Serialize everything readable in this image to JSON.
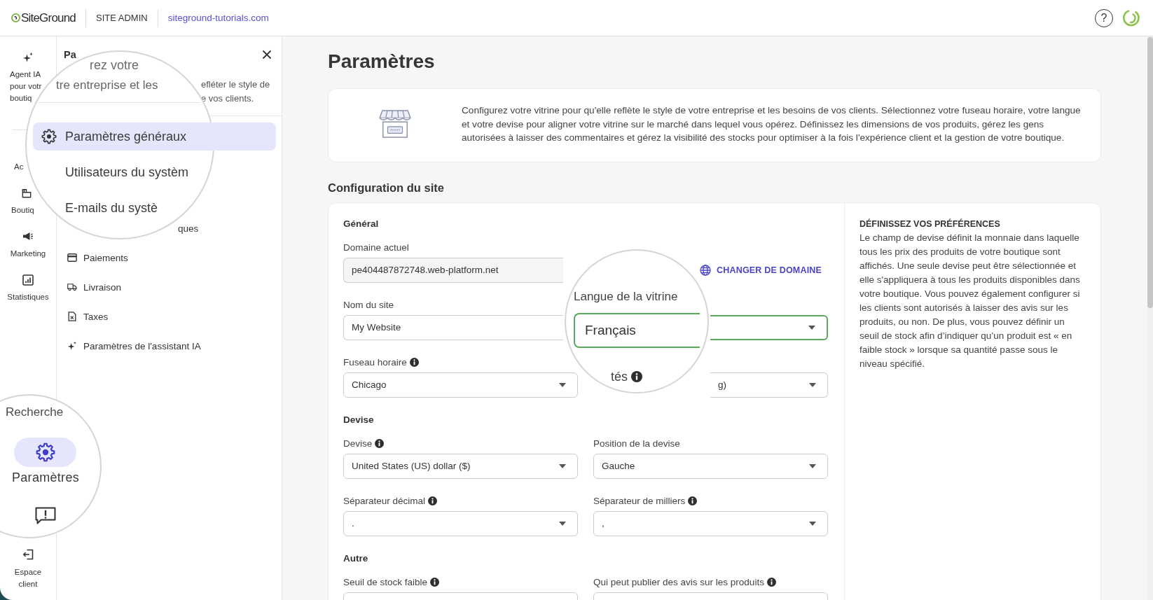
{
  "topbar": {
    "logo": "SiteGround",
    "section": "SITE ADMIN",
    "site_link": "siteground-tutorials.com",
    "help": "?"
  },
  "rail": {
    "items": [
      {
        "lines": [
          "Agent IA",
          "pour votr",
          "boutiq"
        ],
        "selected": false
      },
      {
        "lines": [
          "Ac"
        ],
        "selected": false
      },
      {
        "lines": [
          "Boutiq"
        ],
        "selected": false
      },
      {
        "lines": [
          "Marketing"
        ],
        "selected": false
      },
      {
        "lines": [
          "Statistiques"
        ],
        "selected": false
      },
      {
        "lines": [
          "Espace",
          "client"
        ],
        "selected": false
      }
    ]
  },
  "panel": {
    "title": "Pa",
    "description_lines": [
      "efléter le style de",
      "e vos clients."
    ],
    "items": [
      {
        "label": "ques",
        "selected": false
      },
      {
        "label": "Paiements",
        "selected": false
      },
      {
        "label": "Livraison",
        "selected": false
      },
      {
        "label": "Taxes",
        "selected": false
      },
      {
        "label": "Paramètres de l'assistant IA",
        "selected": false
      }
    ]
  },
  "main": {
    "title": "Paramètres",
    "intro": "Configurez votre vitrine pour qu'elle reflète le style de votre entreprise et les besoins de vos clients. Sélectionnez votre fuseau horaire, votre langue et votre devise pour aligner votre vitrine sur le marché dans lequel vous opérez. Définissez les dimensions de vos produits, gérez les gens autorisées à laisser des commentaires et gérez la visibilité des stocks pour optimiser à la fois l'expérience client et la gestion de votre boutique.",
    "section_title": "Configuration du site",
    "groups": [
      {
        "title": "Général",
        "fields": [
          {
            "kind": "domain",
            "label": "Domaine actuel",
            "value": "pe404487872748.web-platform.net",
            "action": "CHANGER DE DOMAINE",
            "info": false,
            "focused": false
          },
          {
            "kind": "text",
            "label": "Nom du site",
            "value": "My Website",
            "info": false,
            "focused": false
          },
          {
            "kind": "select",
            "focused": true
          },
          {
            "kind": "select",
            "label": "Fuseau horaire",
            "value": "Chicago",
            "info": true,
            "focused": false
          },
          {
            "kind": "select",
            "value": "g)",
            "focused": false
          }
        ]
      },
      {
        "title": "Devise",
        "fields": [
          {
            "kind": "select",
            "label": "Devise",
            "value": "United States (US) dollar ($)",
            "info": true,
            "focused": false
          },
          {
            "kind": "select",
            "label": "Position de la devise",
            "value": "Gauche",
            "info": false,
            "focused": false
          },
          {
            "kind": "select",
            "label": "Séparateur décimal",
            "value": ".",
            "info": true,
            "focused": false
          },
          {
            "kind": "select",
            "label": "Séparateur de milliers",
            "value": ",",
            "info": true,
            "focused": false
          }
        ]
      },
      {
        "title": "Autre",
        "fields": [
          {
            "kind": "text",
            "label": "Seuil de stock faible",
            "info": true,
            "focused": false
          },
          {
            "kind": "text",
            "label": "Qui peut publier des avis sur les produits",
            "info": true,
            "focused": false
          }
        ]
      }
    ],
    "help": {
      "title": "DÉFINISSEZ VOS PRÉFÉRENCES",
      "text": "Le champ de devise définit la monnaie dans laquelle tous les prix des produits de votre boutique sont affichés. Une seule devise peut être sélectionnée et elle s'appliquera à tous les produits disponibles dans votre boutique. Vous pouvez également configurer si les clients sont autorisés à laisser des avis sur les produits, ou non. De plus, vous pouvez définir un seuil de stock afin d’indiquer qu’un produit est « en faible stock » lorsque sa quantité passe sous le niveau spécifié."
    }
  },
  "lens_panel": {
    "title": "rez votre",
    "subtitle": "tre entreprise et les",
    "items": [
      {
        "label": "Paramètres généraux",
        "selected": true
      },
      {
        "label": "Utilisateurs du systèm",
        "selected": false
      },
      {
        "label": "E-mails du systè",
        "selected": false
      }
    ]
  },
  "lens_rail": {
    "items": [
      {
        "label": "Recherche",
        "selected": false
      },
      {
        "label": "Paramètres",
        "selected": true
      }
    ]
  },
  "lens_field": {
    "label": "Langue de la vitrine",
    "value": "Français",
    "focused": true,
    "next_label": {
      "text": "tés",
      "info": true
    }
  }
}
